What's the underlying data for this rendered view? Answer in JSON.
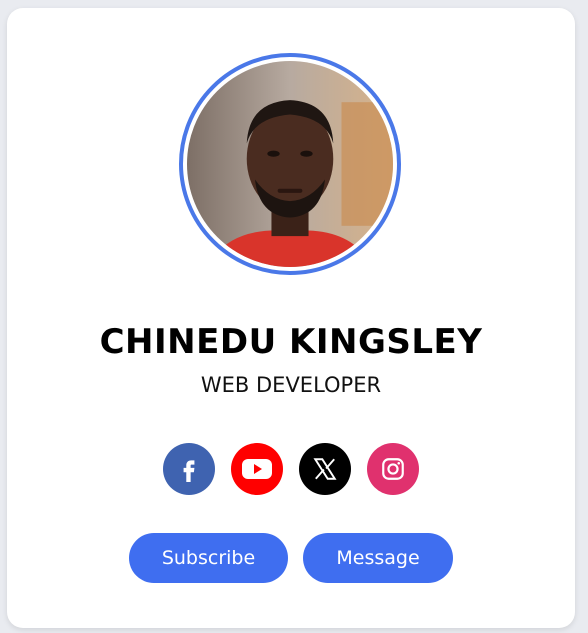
{
  "profile": {
    "name": "CHINEDU KINGSLEY",
    "role": "WEB DEVELOPER",
    "avatar_alt": "profile photo"
  },
  "colors": {
    "accent": "#4a78e8",
    "button": "#3f6ef0",
    "facebook": "#3b5998",
    "youtube": "#ff0000",
    "x": "#000000",
    "instagram": "#e1306c"
  },
  "socials": [
    {
      "icon": "facebook-icon",
      "label": "facebook"
    },
    {
      "icon": "youtube-icon",
      "label": "youtube"
    },
    {
      "icon": "x-icon",
      "label": "x"
    },
    {
      "icon": "instagram-icon",
      "label": "instagram"
    }
  ],
  "actions": {
    "subscribe_label": "Subscribe",
    "message_label": "Message"
  }
}
